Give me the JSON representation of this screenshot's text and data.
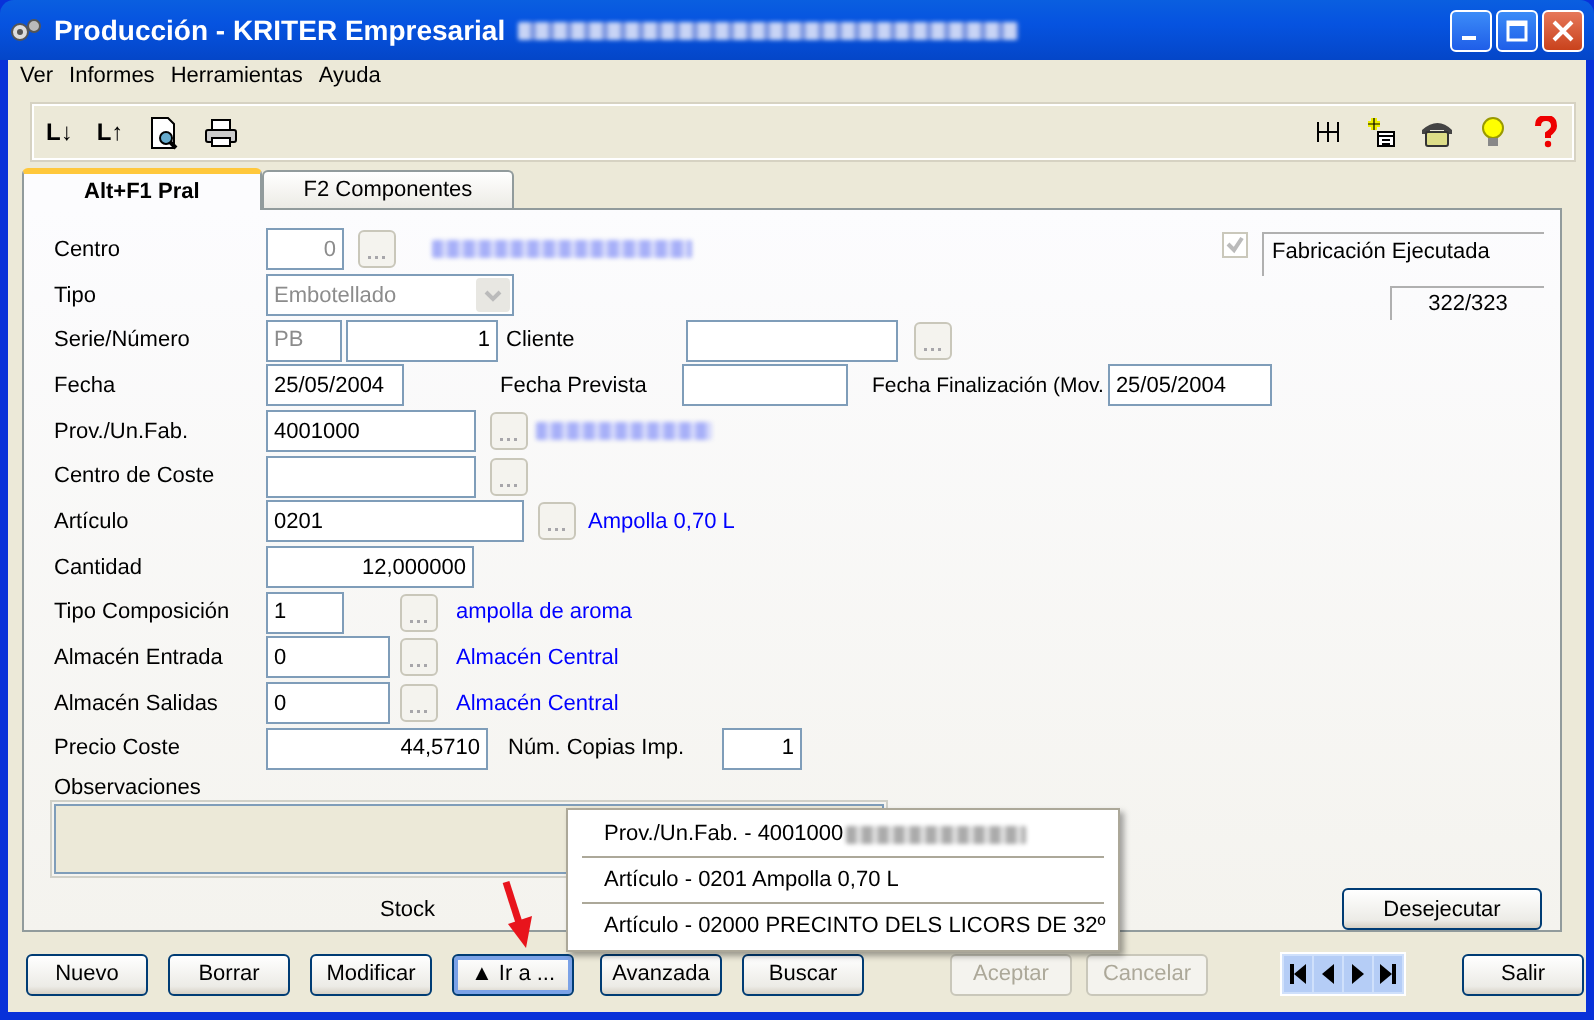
{
  "window": {
    "title": "Producción - KRITER Empresarial"
  },
  "menu": [
    "Ver",
    "Informes",
    "Herramientas",
    "Ayuda"
  ],
  "toolbar": {
    "left_texts": [
      "L↓",
      "L↑"
    ]
  },
  "tabs": [
    {
      "label": "Alt+F1 Pral",
      "selected": true
    },
    {
      "label": "F2 Componentes",
      "selected": false
    }
  ],
  "form": {
    "centro": {
      "label": "Centro",
      "value": "0",
      "disabled": true
    },
    "fabricacion_ejecutada": {
      "label": "Fabricación Ejecutada",
      "checked": true,
      "disabled": true
    },
    "counter": "322/323",
    "tipo": {
      "label": "Tipo",
      "value": "Embotellado",
      "disabled": true
    },
    "serie_numero": {
      "label": "Serie/Número",
      "serie": "PB",
      "numero": "1",
      "disabled": true
    },
    "cliente": {
      "label": "Cliente"
    },
    "fecha": {
      "label": "Fecha",
      "value": "25/05/2004"
    },
    "fecha_prevista": {
      "label": "Fecha Prevista"
    },
    "fecha_finalizacion": {
      "label": "Fecha Finalización (Mov.",
      "value": "25/05/2004"
    },
    "prov_un_fab": {
      "label": "Prov./Un.Fab.",
      "value": "4001000"
    },
    "centro_coste": {
      "label": "Centro de Coste"
    },
    "articulo": {
      "label": "Artículo",
      "value": "0201",
      "description": "Ampolla 0,70 L"
    },
    "cantidad": {
      "label": "Cantidad",
      "value": "12,000000"
    },
    "tipo_composicion": {
      "label": "Tipo Composición",
      "value": "1",
      "description": "ampolla de aroma"
    },
    "almacen_entrada": {
      "label": "Almacén Entrada",
      "value": "0",
      "description": "Almacén Central"
    },
    "almacen_salidas": {
      "label": "Almacén Salidas",
      "value": "0",
      "description": "Almacén Central"
    },
    "precio_coste": {
      "label": "Precio Coste",
      "value": "44,5710"
    },
    "num_copias": {
      "label": "Núm. Copias Imp.",
      "value": "1"
    },
    "observaciones": {
      "label": "Observaciones",
      "disabled": true
    },
    "stock_label": "Stock",
    "desejecutar": {
      "label": "Desejecutar"
    }
  },
  "popup_menu": [
    {
      "label": "Prov./Un.Fab. - 4001000",
      "blurred": true
    },
    {
      "label": "Artículo - 0201 Ampolla 0,70 L",
      "blurred": false
    },
    {
      "label": "Artículo - 02000 PRECINTO DELS LICORS DE 32º",
      "blurred": false
    }
  ],
  "buttons": [
    {
      "label": "Nuevo",
      "disabled": false,
      "focused": false
    },
    {
      "label": "Borrar",
      "disabled": false,
      "focused": false
    },
    {
      "label": "Modificar",
      "disabled": false,
      "focused": false
    },
    {
      "label": "▲ Ir a ...",
      "disabled": false,
      "focused": true
    },
    {
      "label": "Avanzada",
      "disabled": false,
      "focused": false
    },
    {
      "label": "Buscar",
      "disabled": false,
      "focused": false
    },
    {
      "label": "Aceptar",
      "disabled": true,
      "focused": false
    },
    {
      "label": "Cancelar",
      "disabled": true,
      "focused": false
    },
    {
      "label": "Salir",
      "disabled": false,
      "focused": false
    }
  ]
}
